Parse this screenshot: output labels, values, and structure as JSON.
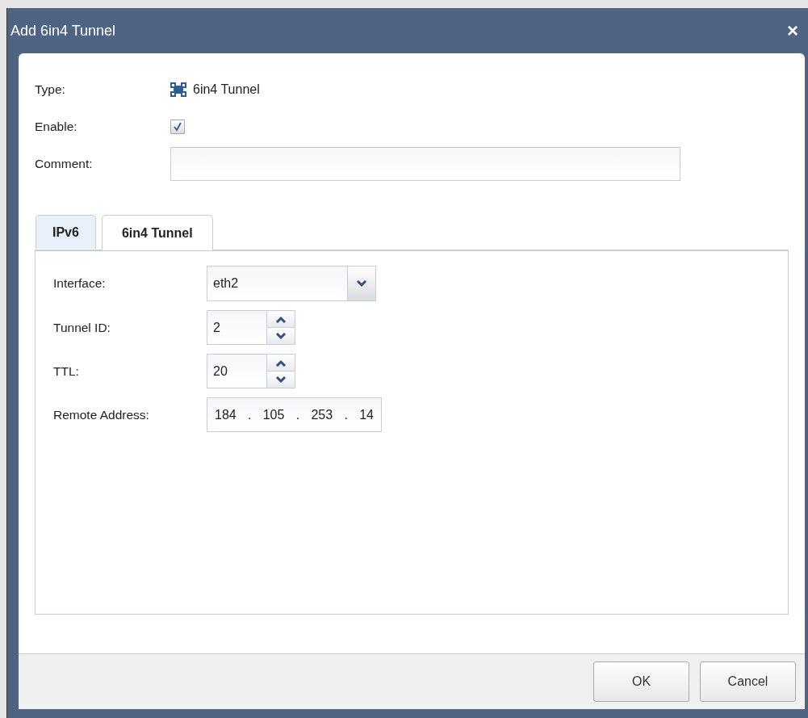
{
  "window": {
    "title": "Add 6in4 Tunnel",
    "close": "×"
  },
  "general": {
    "type_label": "Type:",
    "type_value": "6in4 Tunnel",
    "enable_label": "Enable:",
    "enable_checked": true,
    "comment_label": "Comment:"
  },
  "tabs": [
    {
      "label": "IPv6",
      "selected": false
    },
    {
      "label": "6in4 Tunnel",
      "selected": true
    }
  ],
  "fields": [
    {
      "kind": "select",
      "label": "Interface:",
      "value": "eth2"
    },
    {
      "kind": "spinner",
      "label": "Tunnel ID:",
      "value": "2"
    },
    {
      "kind": "spinner",
      "label": "TTL:",
      "value": "20"
    },
    {
      "kind": "ip",
      "label": "Remote Address:",
      "octets": [
        "184",
        "105",
        "253",
        "14"
      ],
      "separator": "."
    }
  ],
  "buttons": [
    {
      "label": "OK"
    },
    {
      "label": "Cancel"
    }
  ]
}
